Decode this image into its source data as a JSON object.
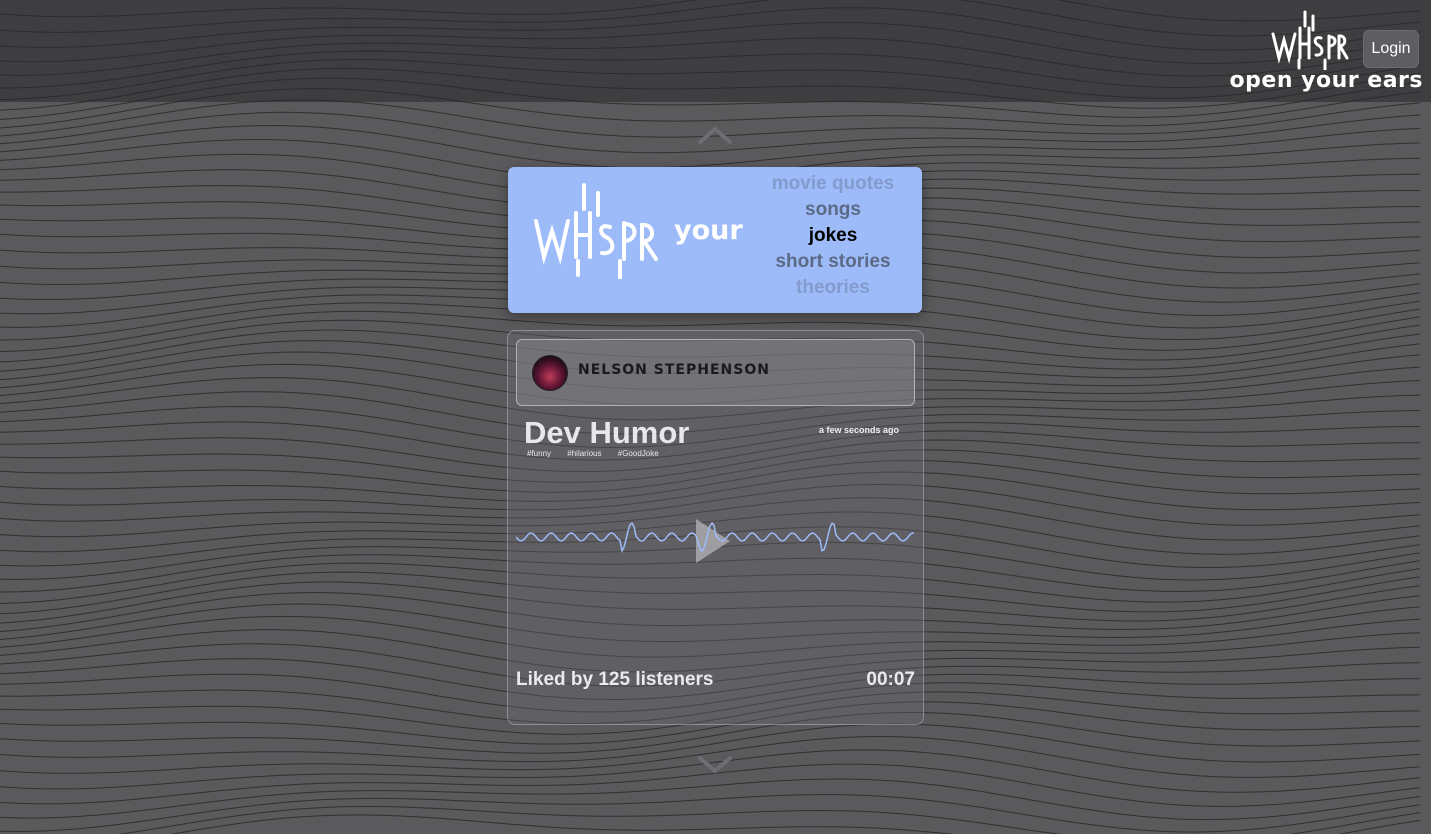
{
  "header": {
    "logo_text": "WHSPR",
    "tagline": "open your ears",
    "login_label": "Login"
  },
  "hero": {
    "logo_text": "WHSPR",
    "prefix": "your",
    "topics": [
      "movie quotes",
      "songs",
      "jokes",
      "short stories",
      "theories"
    ],
    "active_topic": "jokes"
  },
  "post": {
    "author": "NELSON STEPHENSON",
    "title": "Dev Humor",
    "time": "a few seconds ago",
    "tags": [
      "#funny",
      "#hilarious",
      "#GoodJoke"
    ],
    "likes": "Liked by 125 listeners",
    "duration": "00:07"
  },
  "colors": {
    "hero_bg": "#9dbbf9",
    "wave": "#9dbbf9",
    "background": "#5a5a5c"
  },
  "icons": [
    "chevron-up-icon",
    "chevron-down-icon",
    "play-icon",
    "whspr-logo"
  ]
}
